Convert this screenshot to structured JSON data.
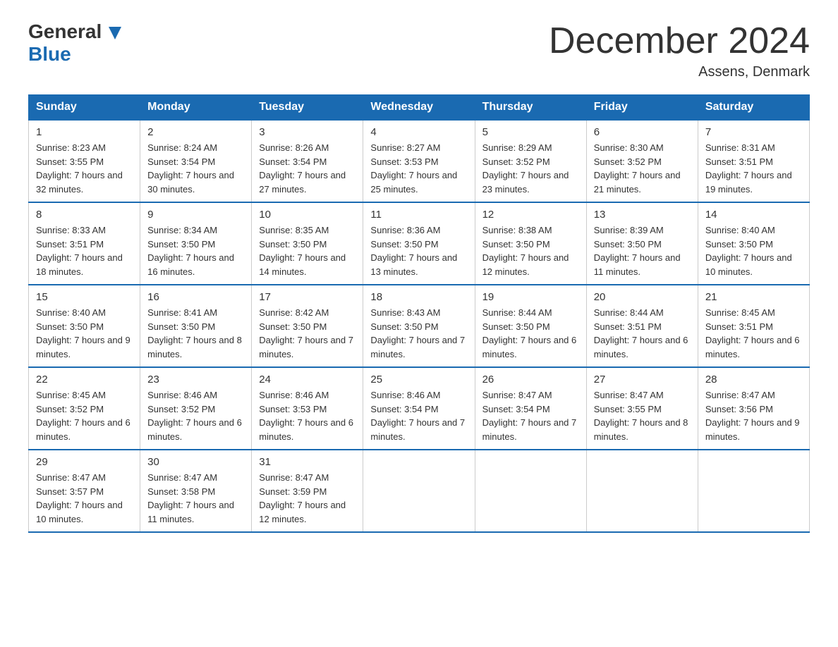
{
  "header": {
    "logo_line1": "General",
    "logo_line2": "Blue",
    "month_title": "December 2024",
    "location": "Assens, Denmark"
  },
  "weekdays": [
    "Sunday",
    "Monday",
    "Tuesday",
    "Wednesday",
    "Thursday",
    "Friday",
    "Saturday"
  ],
  "weeks": [
    [
      {
        "day": "1",
        "sunrise": "8:23 AM",
        "sunset": "3:55 PM",
        "daylight": "7 hours and 32 minutes."
      },
      {
        "day": "2",
        "sunrise": "8:24 AM",
        "sunset": "3:54 PM",
        "daylight": "7 hours and 30 minutes."
      },
      {
        "day": "3",
        "sunrise": "8:26 AM",
        "sunset": "3:54 PM",
        "daylight": "7 hours and 27 minutes."
      },
      {
        "day": "4",
        "sunrise": "8:27 AM",
        "sunset": "3:53 PM",
        "daylight": "7 hours and 25 minutes."
      },
      {
        "day": "5",
        "sunrise": "8:29 AM",
        "sunset": "3:52 PM",
        "daylight": "7 hours and 23 minutes."
      },
      {
        "day": "6",
        "sunrise": "8:30 AM",
        "sunset": "3:52 PM",
        "daylight": "7 hours and 21 minutes."
      },
      {
        "day": "7",
        "sunrise": "8:31 AM",
        "sunset": "3:51 PM",
        "daylight": "7 hours and 19 minutes."
      }
    ],
    [
      {
        "day": "8",
        "sunrise": "8:33 AM",
        "sunset": "3:51 PM",
        "daylight": "7 hours and 18 minutes."
      },
      {
        "day": "9",
        "sunrise": "8:34 AM",
        "sunset": "3:50 PM",
        "daylight": "7 hours and 16 minutes."
      },
      {
        "day": "10",
        "sunrise": "8:35 AM",
        "sunset": "3:50 PM",
        "daylight": "7 hours and 14 minutes."
      },
      {
        "day": "11",
        "sunrise": "8:36 AM",
        "sunset": "3:50 PM",
        "daylight": "7 hours and 13 minutes."
      },
      {
        "day": "12",
        "sunrise": "8:38 AM",
        "sunset": "3:50 PM",
        "daylight": "7 hours and 12 minutes."
      },
      {
        "day": "13",
        "sunrise": "8:39 AM",
        "sunset": "3:50 PM",
        "daylight": "7 hours and 11 minutes."
      },
      {
        "day": "14",
        "sunrise": "8:40 AM",
        "sunset": "3:50 PM",
        "daylight": "7 hours and 10 minutes."
      }
    ],
    [
      {
        "day": "15",
        "sunrise": "8:40 AM",
        "sunset": "3:50 PM",
        "daylight": "7 hours and 9 minutes."
      },
      {
        "day": "16",
        "sunrise": "8:41 AM",
        "sunset": "3:50 PM",
        "daylight": "7 hours and 8 minutes."
      },
      {
        "day": "17",
        "sunrise": "8:42 AM",
        "sunset": "3:50 PM",
        "daylight": "7 hours and 7 minutes."
      },
      {
        "day": "18",
        "sunrise": "8:43 AM",
        "sunset": "3:50 PM",
        "daylight": "7 hours and 7 minutes."
      },
      {
        "day": "19",
        "sunrise": "8:44 AM",
        "sunset": "3:50 PM",
        "daylight": "7 hours and 6 minutes."
      },
      {
        "day": "20",
        "sunrise": "8:44 AM",
        "sunset": "3:51 PM",
        "daylight": "7 hours and 6 minutes."
      },
      {
        "day": "21",
        "sunrise": "8:45 AM",
        "sunset": "3:51 PM",
        "daylight": "7 hours and 6 minutes."
      }
    ],
    [
      {
        "day": "22",
        "sunrise": "8:45 AM",
        "sunset": "3:52 PM",
        "daylight": "7 hours and 6 minutes."
      },
      {
        "day": "23",
        "sunrise": "8:46 AM",
        "sunset": "3:52 PM",
        "daylight": "7 hours and 6 minutes."
      },
      {
        "day": "24",
        "sunrise": "8:46 AM",
        "sunset": "3:53 PM",
        "daylight": "7 hours and 6 minutes."
      },
      {
        "day": "25",
        "sunrise": "8:46 AM",
        "sunset": "3:54 PM",
        "daylight": "7 hours and 7 minutes."
      },
      {
        "day": "26",
        "sunrise": "8:47 AM",
        "sunset": "3:54 PM",
        "daylight": "7 hours and 7 minutes."
      },
      {
        "day": "27",
        "sunrise": "8:47 AM",
        "sunset": "3:55 PM",
        "daylight": "7 hours and 8 minutes."
      },
      {
        "day": "28",
        "sunrise": "8:47 AM",
        "sunset": "3:56 PM",
        "daylight": "7 hours and 9 minutes."
      }
    ],
    [
      {
        "day": "29",
        "sunrise": "8:47 AM",
        "sunset": "3:57 PM",
        "daylight": "7 hours and 10 minutes."
      },
      {
        "day": "30",
        "sunrise": "8:47 AM",
        "sunset": "3:58 PM",
        "daylight": "7 hours and 11 minutes."
      },
      {
        "day": "31",
        "sunrise": "8:47 AM",
        "sunset": "3:59 PM",
        "daylight": "7 hours and 12 minutes."
      },
      null,
      null,
      null,
      null
    ]
  ]
}
